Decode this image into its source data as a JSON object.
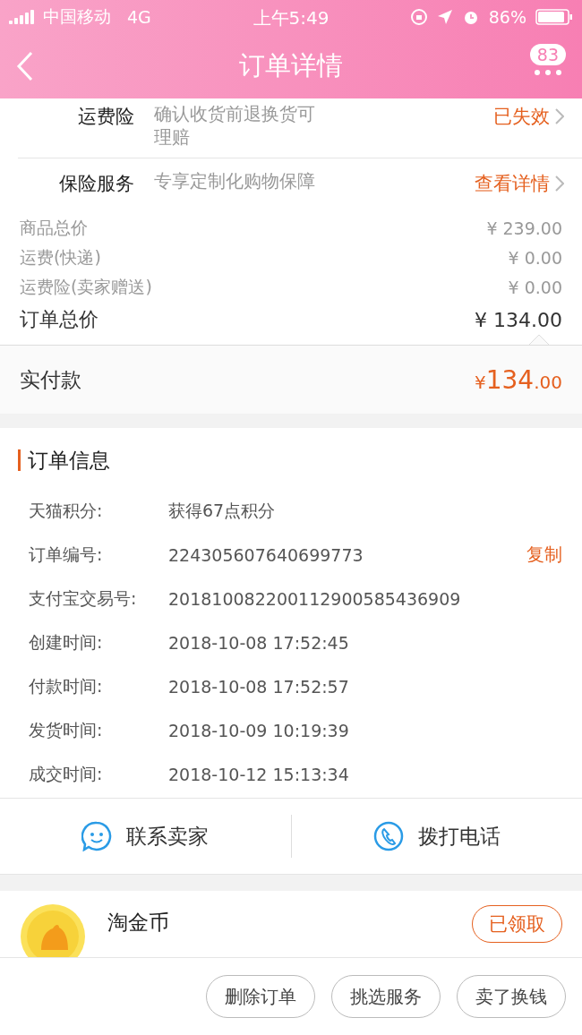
{
  "status_bar": {
    "carrier": "中国移动",
    "network": "4G",
    "time": "上午5:49",
    "battery": "86%"
  },
  "nav": {
    "title": "订单详情",
    "badge": "83"
  },
  "services": [
    {
      "label": "运费险",
      "desc_lines": [
        "确认收货前退换货可",
        "理赔"
      ],
      "action": "已失效"
    },
    {
      "label": "保险服务",
      "desc_lines": [
        "专享定制化购物保障"
      ],
      "action": "查看详情"
    }
  ],
  "prices": [
    {
      "label": "商品总价",
      "value": "¥ 239.00",
      "kind": "minor"
    },
    {
      "label": "运费(快递)",
      "value": "¥ 0.00",
      "kind": "minor"
    },
    {
      "label": "运费险(卖家赠送)",
      "value": "¥ 0.00",
      "kind": "minor"
    },
    {
      "label": "订单总价",
      "value": "¥ 134.00",
      "kind": "major"
    }
  ],
  "paid": {
    "label": "实付款",
    "currency": "¥",
    "integer": "134",
    "decimal": ".00"
  },
  "order_info": {
    "title": "订单信息",
    "rows": [
      {
        "label": "天猫积分:",
        "value": "获得67点积分"
      },
      {
        "label": "订单编号:",
        "value": "224305607640699773",
        "action": "复制"
      },
      {
        "label": "支付宝交易号:",
        "value": "201810082200112900585436909"
      },
      {
        "label": "创建时间:",
        "value": "2018-10-08 17:52:45"
      },
      {
        "label": "付款时间:",
        "value": "2018-10-08 17:52:57"
      },
      {
        "label": "发货时间:",
        "value": "2018-10-09 10:19:39"
      },
      {
        "label": "成交时间:",
        "value": "2018-10-12 15:13:34"
      }
    ]
  },
  "contact": [
    {
      "label": "联系卖家",
      "kind": "chat"
    },
    {
      "label": "拨打电话",
      "kind": "phone"
    }
  ],
  "coin": {
    "title": "淘金币",
    "button": "已领取"
  },
  "actions": [
    "删除订单",
    "挑选服务",
    "卖了换钱"
  ]
}
